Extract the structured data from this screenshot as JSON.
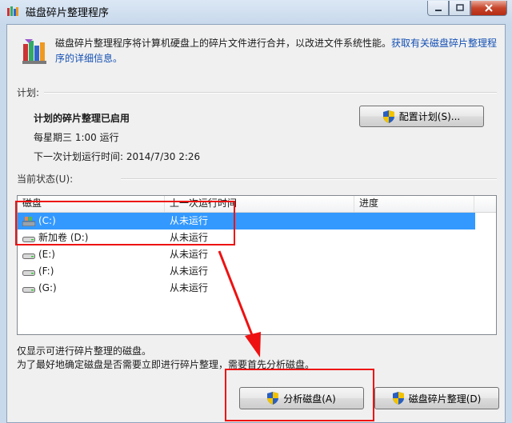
{
  "window": {
    "title": "磁盘碎片整理程序"
  },
  "description": {
    "text": "磁盘碎片整理程序将计算机硬盘上的碎片文件进行合并，以改进文件系统性能。",
    "link": "获取有关磁盘碎片整理程序的详细信息。"
  },
  "schedule": {
    "group_label": "计划:",
    "title": "计划的碎片整理已启用",
    "frequency": "每星期三 1:00 运行",
    "next_run": "下一次计划运行时间: 2014/7/30 2:26",
    "configure_button": "配置计划(S)..."
  },
  "status": {
    "group_label": "当前状态(U):",
    "columns": [
      "磁盘",
      "上一次运行时间",
      "进度"
    ],
    "rows": [
      {
        "name": "(C:)",
        "last_run": "从未运行",
        "progress": "",
        "selected": true,
        "icon": "system-drive-icon"
      },
      {
        "name": "新加卷 (D:)",
        "last_run": "从未运行",
        "progress": "",
        "selected": false,
        "icon": "drive-icon"
      },
      {
        "name": "(E:)",
        "last_run": "从未运行",
        "progress": "",
        "selected": false,
        "icon": "drive-icon"
      },
      {
        "name": "(F:)",
        "last_run": "从未运行",
        "progress": "",
        "selected": false,
        "icon": "drive-icon"
      },
      {
        "name": "(G:)",
        "last_run": "从未运行",
        "progress": "",
        "selected": false,
        "icon": "drive-icon"
      }
    ]
  },
  "notes": {
    "line1": "仅显示可进行碎片整理的磁盘。",
    "line2": "为了最好地确定磁盘是否需要立即进行碎片整理，需要首先分析磁盘。"
  },
  "actions": {
    "analyze_button": "分析磁盘(A)",
    "defrag_button": "磁盘碎片整理(D)"
  },
  "colors": {
    "annotation": "#ee1111",
    "selection": "#3399ff",
    "link": "#1450b4"
  }
}
